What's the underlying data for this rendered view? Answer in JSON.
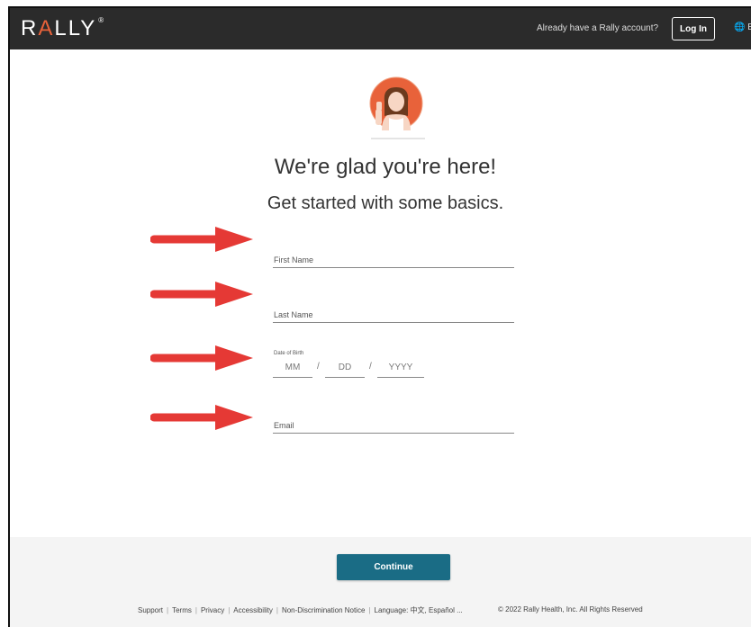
{
  "header": {
    "logo": "RALLY",
    "already_text": "Already have a Rally account?",
    "login_label": "Log In",
    "language_label": "E"
  },
  "main": {
    "heading": "We're glad you're here!",
    "subheading": "Get started with some basics.",
    "first_name_label": "First Name",
    "last_name_label": "Last Name",
    "dob_label": "Date of Birth",
    "dob_month": "MM",
    "dob_day": "DD",
    "dob_year": "YYYY",
    "dob_sep": "/",
    "email_label": "Email"
  },
  "footer": {
    "continue_label": "Continue",
    "links": [
      "Support",
      "Terms",
      "Privacy",
      "Accessibility",
      "Non-Discrimination Notice",
      "Language: 中文, Español ..."
    ],
    "copyright": "© 2022 Rally Health, Inc. All Rights Reserved"
  },
  "colors": {
    "header_bg": "#2b2b2b",
    "accent_orange": "#e8623a",
    "continue_bg": "#1a6c85",
    "arrow_red": "#e53935"
  }
}
